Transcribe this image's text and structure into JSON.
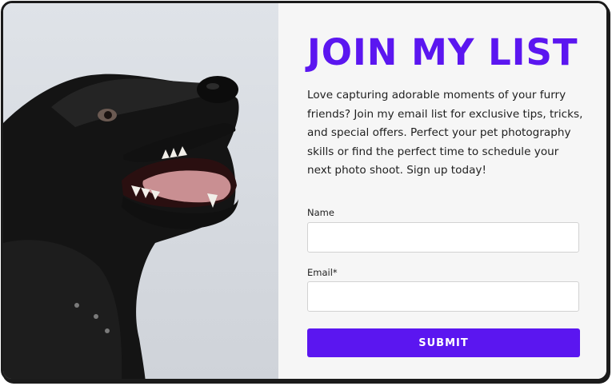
{
  "signup": {
    "title": "JOIN MY LIST",
    "intro": "Love capturing adorable moments of your furry friends? Join my email list for exclusive tips, tricks, and special offers. Perfect your pet photography skills or find the perfect time to schedule your next photo shoot.  Sign up today!",
    "name_label": "Name",
    "name_value": "",
    "email_label": "Email*",
    "email_value": "",
    "submit_label": "SUBMIT"
  },
  "colors": {
    "accent": "#5b16f0",
    "panel_background": "#f6f6f6",
    "photo_background": "#d9dde2",
    "border": "#1b1b1b"
  },
  "image": {
    "subject": "black dog with open mouth looking up"
  }
}
